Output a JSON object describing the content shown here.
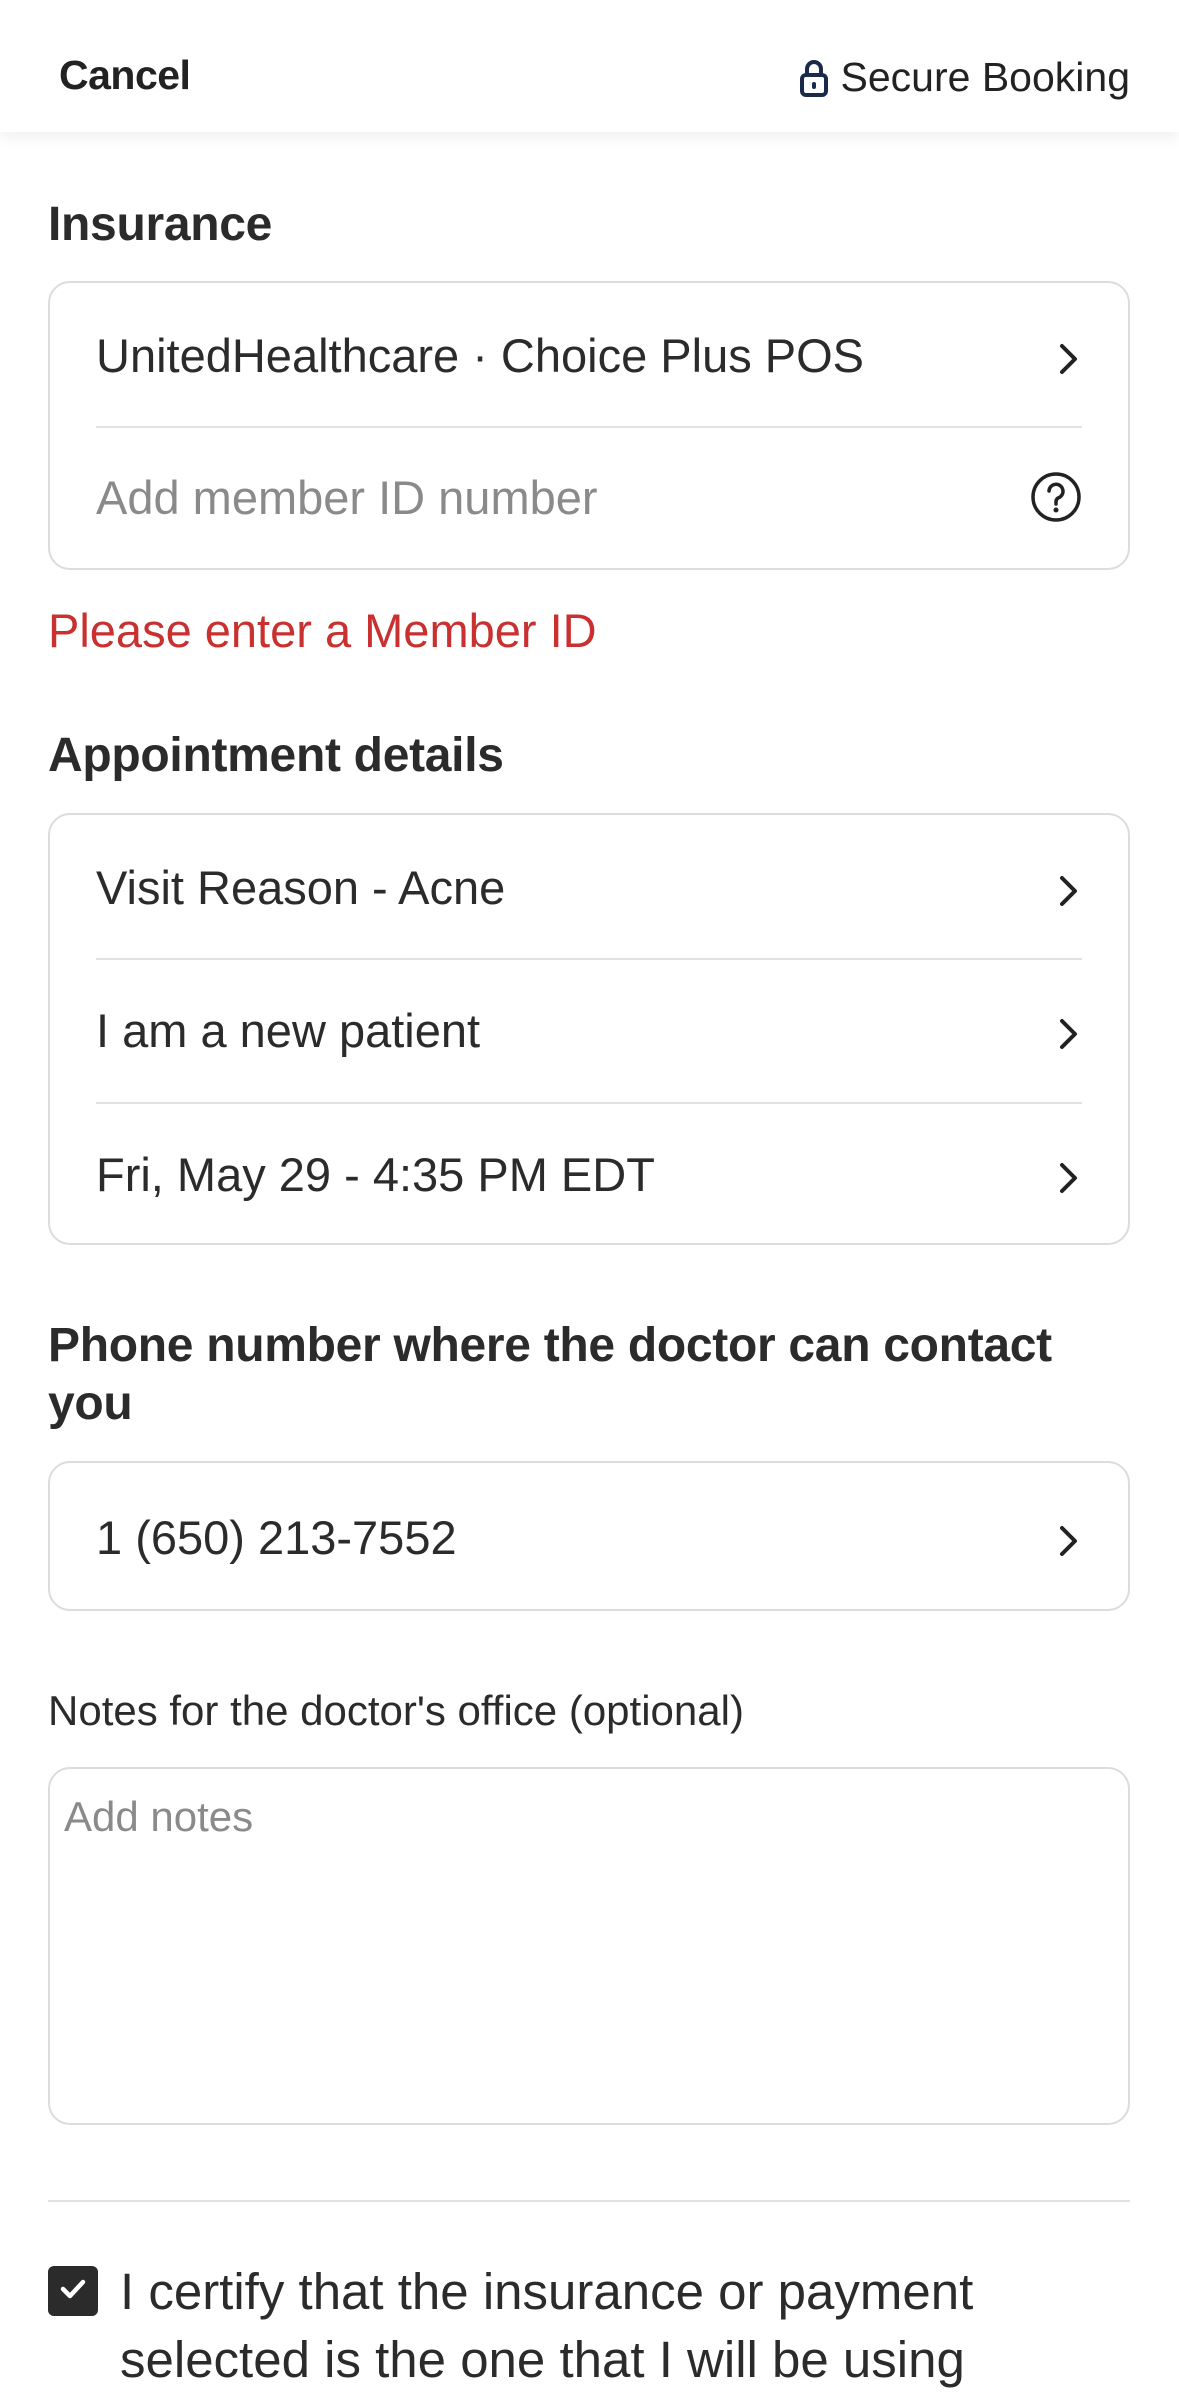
{
  "header": {
    "cancel_label": "Cancel",
    "secure_label": "Secure Booking"
  },
  "insurance": {
    "title": "Insurance",
    "plan": "UnitedHealthcare · Choice Plus POS",
    "member_id_placeholder": "Add member ID number",
    "error": "Please enter a Member ID"
  },
  "appointment": {
    "title": "Appointment details",
    "items": [
      {
        "label": "Visit Reason - Acne"
      },
      {
        "label": "I am a new patient"
      },
      {
        "label": "Fri, May 29 - 4:35 PM EDT"
      }
    ]
  },
  "phone": {
    "title": "Phone number where the doctor can contact you",
    "value": "1 (650) 213-7552"
  },
  "notes": {
    "label": "Notes for the doctor's office (optional)",
    "placeholder": "Add notes"
  },
  "certify": {
    "checked": true,
    "text": "I certify that the insurance or payment selected is the one that I will be using"
  },
  "icons": {
    "lock": "lock-icon",
    "chevron": "chevron-right-icon",
    "help": "question-circle-icon",
    "check": "checkmark-icon"
  },
  "colors": {
    "error": "#c8312f",
    "text": "#2b2b2b",
    "placeholder": "#8a8a8a",
    "border": "#dcdcdc",
    "lock": "#1a2b4a"
  }
}
